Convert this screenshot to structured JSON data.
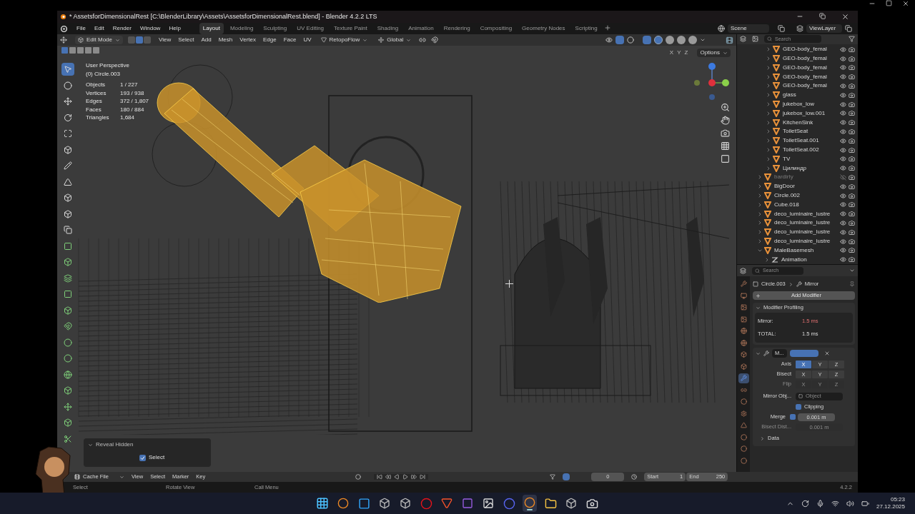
{
  "window": {
    "title": "* AssetsforDimensionalRest [C:\\BlenderLibrary\\Assets\\AssetsforDimensionalRest.blend] - Blender 4.2.2 LTS"
  },
  "menu": [
    "File",
    "Edit",
    "Render",
    "Window",
    "Help"
  ],
  "workspaces": [
    {
      "label": "Layout",
      "selected": true
    },
    {
      "label": "Modeling",
      "selected": false
    },
    {
      "label": "Sculpting",
      "selected": false
    },
    {
      "label": "UV Editing",
      "selected": false
    },
    {
      "label": "Texture Paint",
      "selected": false
    },
    {
      "label": "Shading",
      "selected": false
    },
    {
      "label": "Animation",
      "selected": false
    },
    {
      "label": "Rendering",
      "selected": false
    },
    {
      "label": "Compositing",
      "selected": false
    },
    {
      "label": "Geometry Nodes",
      "selected": false
    },
    {
      "label": "Scripting",
      "selected": false
    }
  ],
  "scene": "Scene",
  "view_layer": "ViewLayer",
  "viewport": {
    "mode": "Edit Mode",
    "select_modes": [
      {
        "selected": false
      },
      {
        "selected": true
      },
      {
        "selected": false
      }
    ],
    "menus": [
      "View",
      "Select",
      "Add",
      "Mesh",
      "Vertex",
      "Edge",
      "Face",
      "UV"
    ],
    "addon": "RetopoFlow",
    "orientation": "Global",
    "xray": {
      "on": true
    },
    "shading_modes": [
      {
        "selected": true
      },
      {
        "selected": false
      },
      {
        "selected": false
      },
      {
        "selected": false
      }
    ],
    "axes": [
      "X",
      "Y",
      "Z"
    ],
    "options": "Options",
    "view_name": "User Perspective",
    "object_name": "(0) Circle.003",
    "stats": [
      {
        "label": "Objects",
        "value": "1 / 227"
      },
      {
        "label": "Vertices",
        "value": "193 / 938"
      },
      {
        "label": "Edges",
        "value": "372 / 1,807"
      },
      {
        "label": "Faces",
        "value": "180 / 884"
      },
      {
        "label": "Triangles",
        "value": "1,684"
      }
    ],
    "tools": [
      {
        "selected": true
      },
      {
        "selected": false
      },
      {
        "selected": false
      },
      {
        "selected": false
      },
      {
        "selected": false
      },
      {
        "selected": false
      },
      {
        "selected": false
      },
      {
        "selected": false
      },
      {
        "selected": false
      },
      {
        "selected": false
      },
      {
        "selected": false
      },
      {
        "selected": false
      },
      {
        "selected": false
      },
      {
        "selected": false
      },
      {
        "selected": false
      },
      {
        "selected": false
      },
      {
        "selected": false
      },
      {
        "selected": false
      },
      {
        "selected": false
      },
      {
        "selected": false
      },
      {
        "selected": false
      },
      {
        "selected": false
      },
      {
        "selected": false
      },
      {
        "selected": false
      }
    ],
    "reveal_panel": {
      "title": "Reveal Hidden",
      "option": {
        "label": "Select",
        "checked": true
      }
    }
  },
  "outliner": {
    "search_placeholder": "Search",
    "nested_items": [
      {
        "label": "GEO-body_femal",
        "kind": "mesh",
        "expanded": false,
        "visible": true,
        "disabled": false
      },
      {
        "label": "GEO-body_femal",
        "kind": "mesh",
        "expanded": false,
        "visible": true,
        "disabled": false
      },
      {
        "label": "GEO-body_femal",
        "kind": "mesh",
        "expanded": false,
        "visible": true,
        "disabled": false
      },
      {
        "label": "GEO-body_femal",
        "kind": "mesh",
        "expanded": false,
        "visible": true,
        "disabled": false
      },
      {
        "label": "GEO-body_femal",
        "kind": "mesh",
        "expanded": false,
        "visible": true,
        "disabled": false
      },
      {
        "label": "glass",
        "kind": "mesh",
        "expanded": false,
        "visible": true,
        "disabled": false
      },
      {
        "label": "jukebox_low",
        "kind": "mesh",
        "expanded": false,
        "visible": true,
        "disabled": false
      },
      {
        "label": "jukebox_low.001",
        "kind": "mesh",
        "expanded": false,
        "visible": true,
        "disabled": false
      },
      {
        "label": "KitchenSink",
        "kind": "mesh",
        "expanded": false,
        "visible": true,
        "disabled": false
      },
      {
        "label": "ToiletSeat",
        "kind": "mesh",
        "expanded": false,
        "visible": true,
        "disabled": false
      },
      {
        "label": "ToiletSeat.001",
        "kind": "mesh",
        "expanded": false,
        "visible": true,
        "disabled": false
      },
      {
        "label": "ToiletSeat.002",
        "kind": "mesh",
        "expanded": false,
        "visible": true,
        "disabled": false
      },
      {
        "label": "TV",
        "kind": "mesh",
        "expanded": false,
        "visible": true,
        "disabled": false
      },
      {
        "label": "Цилиндр",
        "kind": "mesh",
        "expanded": false,
        "visible": true,
        "disabled": false
      }
    ],
    "items": [
      {
        "label": "bardirty",
        "kind": "mesh",
        "expanded": false,
        "visible": false,
        "disabled": true
      },
      {
        "label": "BigDoor",
        "kind": "mesh",
        "expanded": false,
        "visible": true,
        "disabled": false
      },
      {
        "label": "Circle.002",
        "kind": "mesh",
        "expanded": false,
        "visible": true,
        "disabled": false
      },
      {
        "label": "Cube.018",
        "kind": "mesh",
        "expanded": false,
        "visible": true,
        "disabled": false
      },
      {
        "label": "deco_luminaire_lustre",
        "kind": "mesh",
        "expanded": false,
        "visible": true,
        "disabled": false
      },
      {
        "label": "deco_luminaire_lustre",
        "kind": "mesh",
        "expanded": false,
        "visible": true,
        "disabled": false
      },
      {
        "label": "deco_luminaire_lustre",
        "kind": "mesh",
        "expanded": false,
        "visible": true,
        "disabled": false
      },
      {
        "label": "deco_luminaire_lustre",
        "kind": "mesh",
        "expanded": false,
        "visible": true,
        "disabled": false
      },
      {
        "label": "MaleBasemesh",
        "kind": "mesh",
        "expanded": true,
        "visible": true,
        "disabled": false,
        "children": [
          {
            "label": "Animation",
            "kind": "animation",
            "expanded": false,
            "visible": true,
            "disabled": false
          }
        ]
      }
    ]
  },
  "properties": {
    "search_placeholder": "Search",
    "tabs": [
      {
        "selected": false
      },
      {
        "selected": false
      },
      {
        "selected": false
      },
      {
        "selected": false
      },
      {
        "selected": false
      },
      {
        "selected": false
      },
      {
        "selected": false
      },
      {
        "selected": false
      },
      {
        "selected": true
      },
      {
        "selected": false
      },
      {
        "selected": false
      },
      {
        "selected": false
      },
      {
        "selected": false
      },
      {
        "selected": false
      },
      {
        "selected": false
      },
      {
        "selected": false
      }
    ],
    "object": "Circle.003",
    "modifier": "Mirror",
    "add_modifier": "Add Modifier",
    "profiling": {
      "title": "Modifier Profiling",
      "rows": [
        {
          "label": "Mirror:",
          "value": "1.5 ms",
          "warning": true
        },
        {
          "label": "TOTAL:",
          "value": "1.5 ms",
          "warning": false
        }
      ]
    },
    "mirror": {
      "name": "M...",
      "axis_rows": [
        {
          "label": "Axis",
          "disabled": false,
          "buttons": [
            {
              "label": "X",
              "selected": true
            },
            {
              "label": "Y",
              "selected": false
            },
            {
              "label": "Z",
              "selected": false
            }
          ]
        },
        {
          "label": "Bisect",
          "disabled": false,
          "buttons": [
            {
              "label": "X",
              "selected": false
            },
            {
              "label": "Y",
              "selected": false
            },
            {
              "label": "Z",
              "selected": false
            }
          ]
        },
        {
          "label": "Flip",
          "disabled": true,
          "buttons": [
            {
              "label": "X",
              "selected": false
            },
            {
              "label": "Y",
              "selected": false
            },
            {
              "label": "Z",
              "selected": false
            }
          ]
        }
      ],
      "mirror_object_label": "Mirror Obj...",
      "mirror_object_placeholder": "Object",
      "clipping": {
        "label": "Clipping",
        "checked": true
      },
      "merge": {
        "label": "Merge",
        "checked": true,
        "value": "0.001 m"
      },
      "bisect_distance": {
        "label": "Bisect Dist...",
        "value": "0.001 m",
        "disabled": true
      },
      "data": {
        "label": "Data",
        "expanded": false
      }
    }
  },
  "timeline": {
    "editor": "Cache File",
    "menus": [
      "View",
      "Select",
      "Marker",
      "Key"
    ],
    "frame": "0",
    "start_label": "Start",
    "start": "1",
    "end_label": "End",
    "end": "250"
  },
  "status_bar": {
    "hints": [
      "Select",
      "Rotate View",
      "Call Menu"
    ],
    "version": "4.2.2"
  },
  "taskbar": {
    "apps": [
      {
        "kind": "start",
        "active": false
      },
      {
        "kind": "blender",
        "active": false
      },
      {
        "kind": "photoshop",
        "active": false
      },
      {
        "kind": "tool",
        "active": false
      },
      {
        "kind": "tool",
        "active": false
      },
      {
        "kind": "opera",
        "active": false
      },
      {
        "kind": "brave",
        "active": false
      },
      {
        "kind": "purple",
        "active": false
      },
      {
        "kind": "picture",
        "active": false
      },
      {
        "kind": "discord",
        "active": false
      },
      {
        "kind": "blender",
        "active": true
      },
      {
        "kind": "folder",
        "active": false
      },
      {
        "kind": "tool",
        "active": false
      },
      {
        "kind": "camera",
        "active": false
      }
    ],
    "time": "05:23",
    "date": "27.12.2025"
  }
}
